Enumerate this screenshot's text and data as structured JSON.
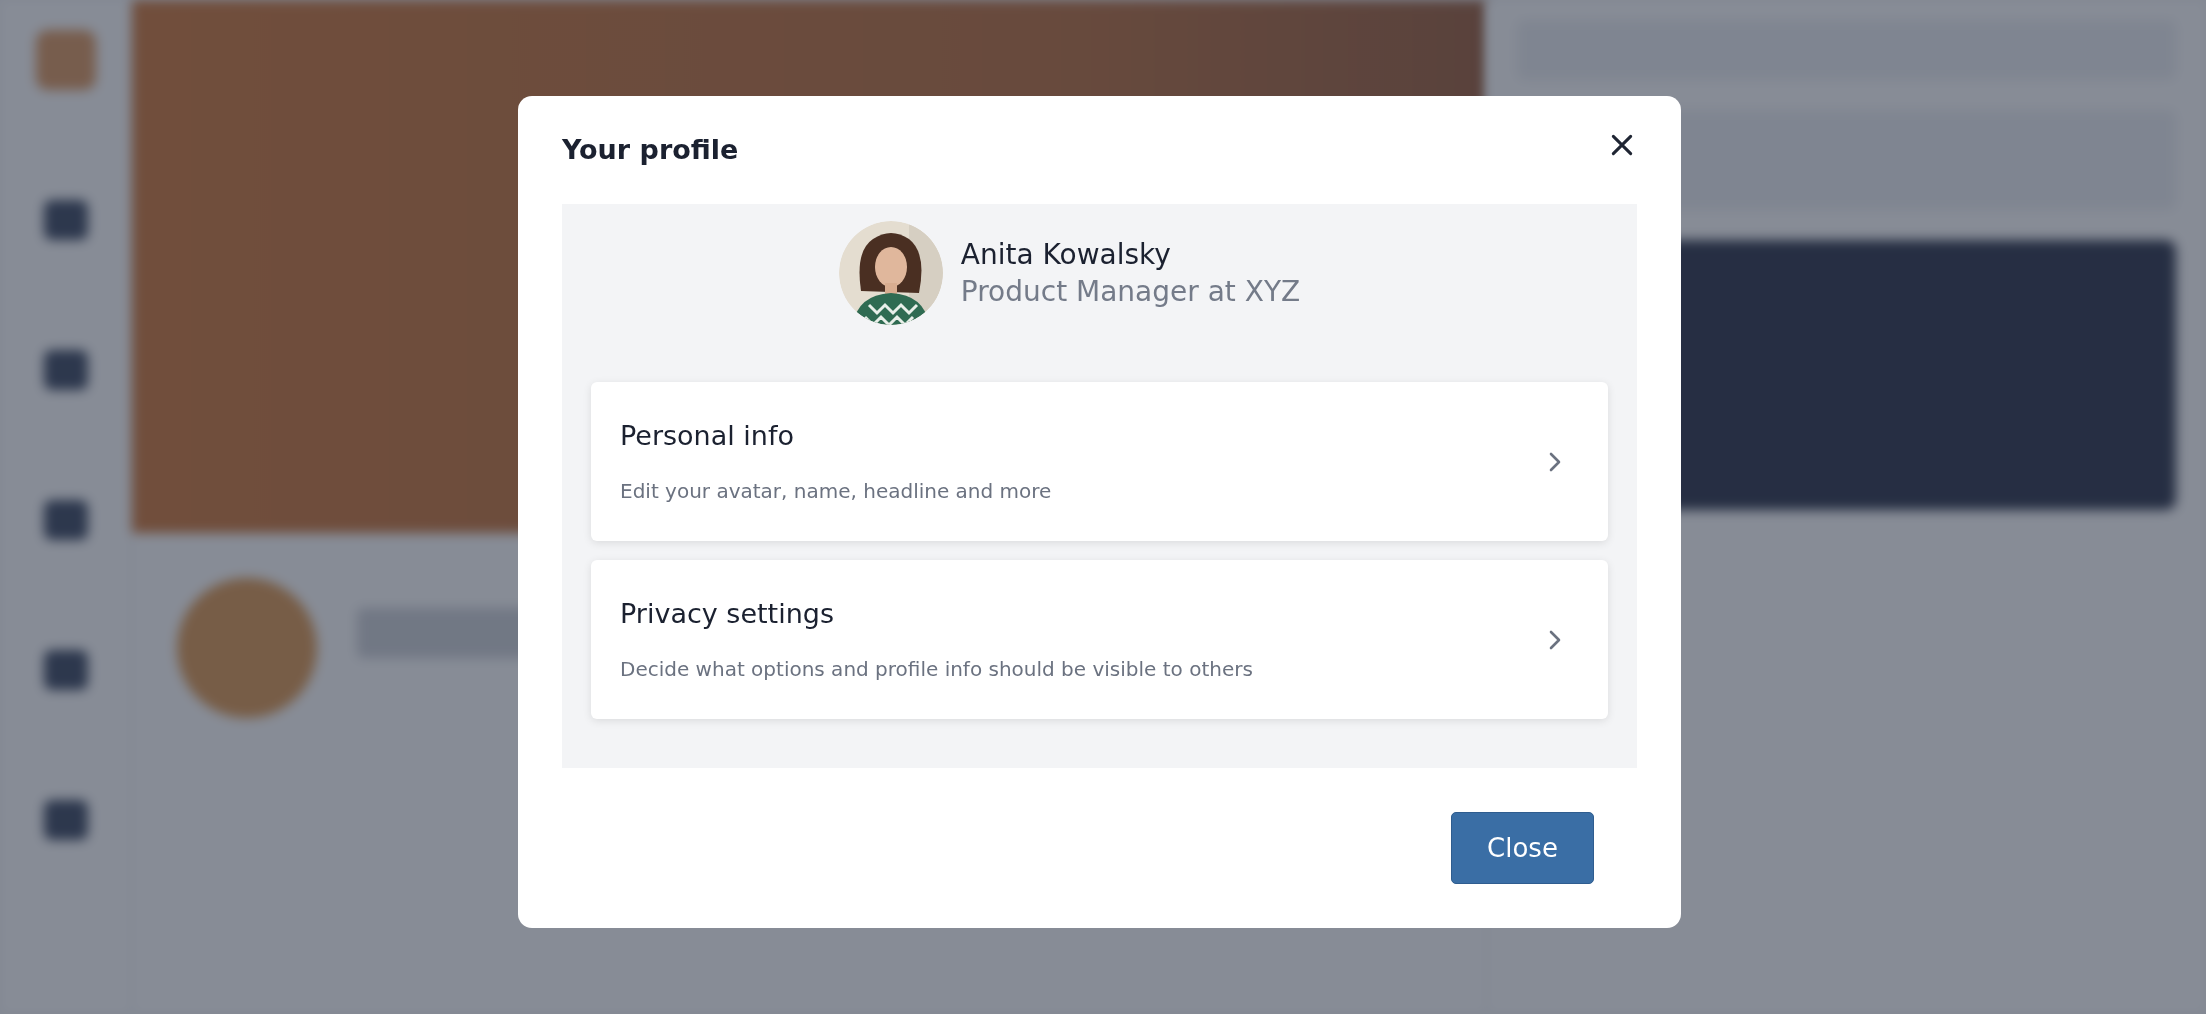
{
  "dialog": {
    "title": "Your profile",
    "profile": {
      "name": "Anita Kowalsky",
      "headline": "Product Manager at XYZ"
    },
    "options": [
      {
        "title": "Personal info",
        "description": "Edit your avatar, name, headline and more"
      },
      {
        "title": "Privacy settings",
        "description": "Decide what options and profile info should be visible to others"
      }
    ],
    "close_button": "Close"
  }
}
